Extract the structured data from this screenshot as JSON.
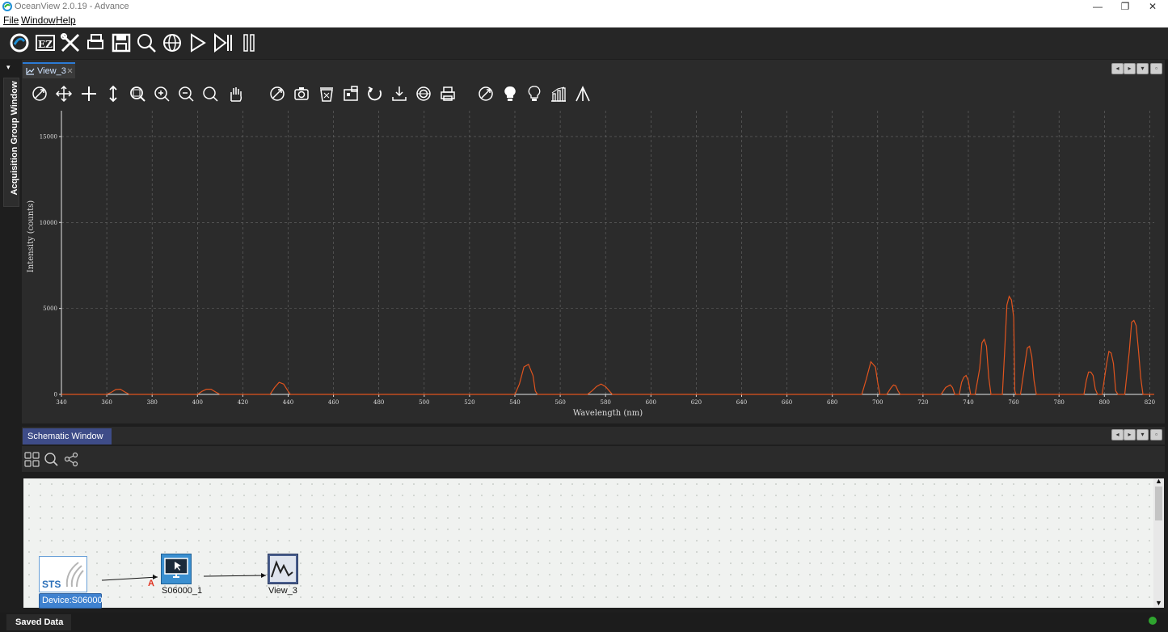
{
  "window": {
    "title": "OceanView 2.0.19 - Advance",
    "minimize_glyph": "—",
    "restore_glyph": "❐",
    "close_glyph": "✕"
  },
  "menu": [
    {
      "label": "File"
    },
    {
      "label": "Window"
    },
    {
      "label": "Help"
    }
  ],
  "toolbar": {
    "icons": [
      "oceanview-logo-icon",
      "ez-icon",
      "tools-icon",
      "printer-icon",
      "save-icon",
      "search-icon",
      "globe-icon",
      "play-icon",
      "step-forward-icon",
      "pause-icon"
    ]
  },
  "side_panel": {
    "label": "Acquisition Group Window"
  },
  "view_tab": {
    "label": "View_3"
  },
  "plot_toolbar": {
    "icons": [
      "autoscale-icon",
      "pan-icon",
      "zoom-move-icon",
      "vertical-scale-icon",
      "zoom-in-box-icon",
      "zoom-in-icon",
      "zoom-out-icon",
      "zoom-reset-icon",
      "hand-pan-icon",
      "overlay-icon",
      "camera-icon",
      "clear-overlay-icon",
      "convert-icon",
      "reset-icon",
      "export-icon",
      "peaks-icon",
      "print-icon",
      "globe-icon",
      "lamp-on-icon",
      "lamp-off-icon",
      "histogram-icon",
      "peak-marker-icon"
    ]
  },
  "chart_data": {
    "type": "line",
    "xlabel": "Wavelength (nm)",
    "ylabel": "Intensity (counts)",
    "xlim": [
      340,
      822
    ],
    "ylim": [
      0,
      16500
    ],
    "x_ticks": [
      340,
      360,
      380,
      400,
      420,
      440,
      460,
      480,
      500,
      520,
      540,
      560,
      580,
      600,
      620,
      640,
      660,
      680,
      700,
      720,
      740,
      760,
      780,
      800,
      820
    ],
    "y_ticks": [
      0,
      5000,
      10000,
      15000
    ],
    "grid": true,
    "line_color": "#e0541e",
    "series": [
      {
        "values": [
          [
            340,
            0
          ],
          [
            360,
            0
          ],
          [
            362,
            120
          ],
          [
            364,
            280
          ],
          [
            366,
            300
          ],
          [
            368,
            140
          ],
          [
            370,
            0
          ],
          [
            400,
            0
          ],
          [
            402,
            180
          ],
          [
            404,
            300
          ],
          [
            406,
            300
          ],
          [
            408,
            140
          ],
          [
            410,
            0
          ],
          [
            432,
            0
          ],
          [
            434,
            400
          ],
          [
            436,
            700
          ],
          [
            438,
            600
          ],
          [
            440,
            180
          ],
          [
            441,
            0
          ],
          [
            540,
            0
          ],
          [
            542,
            600
          ],
          [
            544,
            1600
          ],
          [
            546,
            1750
          ],
          [
            548,
            1100
          ],
          [
            549,
            200
          ],
          [
            550,
            0
          ],
          [
            572,
            0
          ],
          [
            574,
            200
          ],
          [
            576,
            460
          ],
          [
            578,
            600
          ],
          [
            580,
            450
          ],
          [
            582,
            150
          ],
          [
            583,
            0
          ],
          [
            693,
            0
          ],
          [
            695,
            900
          ],
          [
            697,
            1900
          ],
          [
            699,
            1600
          ],
          [
            700,
            700
          ],
          [
            701,
            0
          ],
          [
            704,
            0
          ],
          [
            706,
            400
          ],
          [
            707,
            550
          ],
          [
            708,
            500
          ],
          [
            709,
            200
          ],
          [
            710,
            0
          ],
          [
            728,
            0
          ],
          [
            730,
            400
          ],
          [
            732,
            550
          ],
          [
            733,
            400
          ],
          [
            734,
            0
          ],
          [
            736,
            0
          ],
          [
            737,
            700
          ],
          [
            738,
            1000
          ],
          [
            739,
            1100
          ],
          [
            740,
            800
          ],
          [
            741,
            0
          ],
          [
            743,
            0
          ],
          [
            745,
            1500
          ],
          [
            746,
            3000
          ],
          [
            747,
            3200
          ],
          [
            748,
            2800
          ],
          [
            749,
            1000
          ],
          [
            750,
            0
          ],
          [
            755,
            0
          ],
          [
            756,
            2500
          ],
          [
            757,
            5200
          ],
          [
            758,
            5700
          ],
          [
            759,
            5500
          ],
          [
            760,
            4500
          ],
          [
            760.5,
            200
          ],
          [
            761,
            0
          ],
          [
            763,
            0
          ],
          [
            765,
            1800
          ],
          [
            766,
            2700
          ],
          [
            767,
            2800
          ],
          [
            768,
            2200
          ],
          [
            769,
            800
          ],
          [
            770,
            0
          ],
          [
            791,
            0
          ],
          [
            792,
            800
          ],
          [
            793,
            1300
          ],
          [
            794,
            1300
          ],
          [
            795,
            1100
          ],
          [
            796,
            300
          ],
          [
            797,
            0
          ],
          [
            799,
            0
          ],
          [
            801,
            1800
          ],
          [
            802,
            2500
          ],
          [
            803,
            2400
          ],
          [
            804,
            1800
          ],
          [
            805,
            200
          ],
          [
            806,
            0
          ],
          [
            809,
            0
          ],
          [
            811,
            2500
          ],
          [
            812,
            4200
          ],
          [
            813,
            4300
          ],
          [
            814,
            4000
          ],
          [
            815,
            2600
          ],
          [
            816,
            1000
          ],
          [
            817,
            0
          ],
          [
            822,
            0
          ]
        ]
      }
    ]
  },
  "schematic": {
    "tab_label": "Schematic Window",
    "tools": [
      "layout-icon",
      "search-icon",
      "network-icon"
    ],
    "nodes": {
      "device_text": "STS",
      "device_badge": "Device:S06000",
      "spectrometer_label": "S06000_1",
      "view_label": "View_3",
      "connector_letter": "A"
    }
  },
  "status": {
    "saved_data": "Saved Data"
  }
}
